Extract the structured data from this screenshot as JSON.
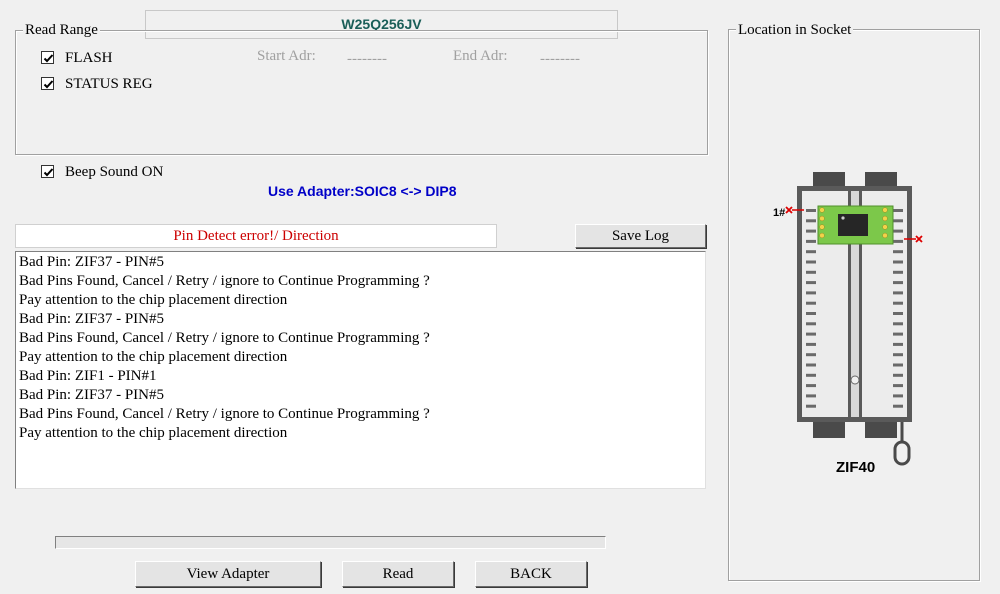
{
  "chip_name": "W25Q256JV",
  "read_range": {
    "legend": "Read Range",
    "flash": {
      "label": "FLASH",
      "checked": true
    },
    "status_reg": {
      "label": "STATUS REG",
      "checked": true
    },
    "start_label": "Start Adr:",
    "start_value": "--------",
    "end_label": "End Adr:",
    "end_value": "--------"
  },
  "beep": {
    "label": "Beep Sound ON",
    "checked": true
  },
  "adapter_text": "Use Adapter:SOIC8 <-> DIP8",
  "status_text": "Pin Detect error!/ Direction",
  "save_log_label": "Save Log",
  "log_lines": [
    "Bad Pin: ZIF37 - PIN#5",
    "Bad Pins Found, Cancel / Retry / ignore to Continue Programming ?",
    "Pay attention to the chip placement direction",
    "Bad Pin: ZIF37 - PIN#5",
    "Bad Pins Found, Cancel / Retry / ignore to Continue Programming ?",
    "Pay attention to the chip placement direction",
    "Bad Pin: ZIF1 - PIN#1",
    "Bad Pin: ZIF37 - PIN#5",
    "Bad Pins Found, Cancel / Retry / ignore to Continue Programming ?",
    "Pay attention to the chip placement direction"
  ],
  "progress_percent": 0,
  "buttons": {
    "view_adapter": "View Adapter",
    "read": "Read",
    "back": "BACK"
  },
  "socket": {
    "legend": "Location in Socket",
    "pin1_label": "1#",
    "name": "ZIF40"
  },
  "colors": {
    "chip_title": "#1a5e58",
    "adapter_text": "#0000c8",
    "status_text": "#cc0000",
    "adapter_pcb": "#7cc84a",
    "error_mark": "#dd0000"
  }
}
